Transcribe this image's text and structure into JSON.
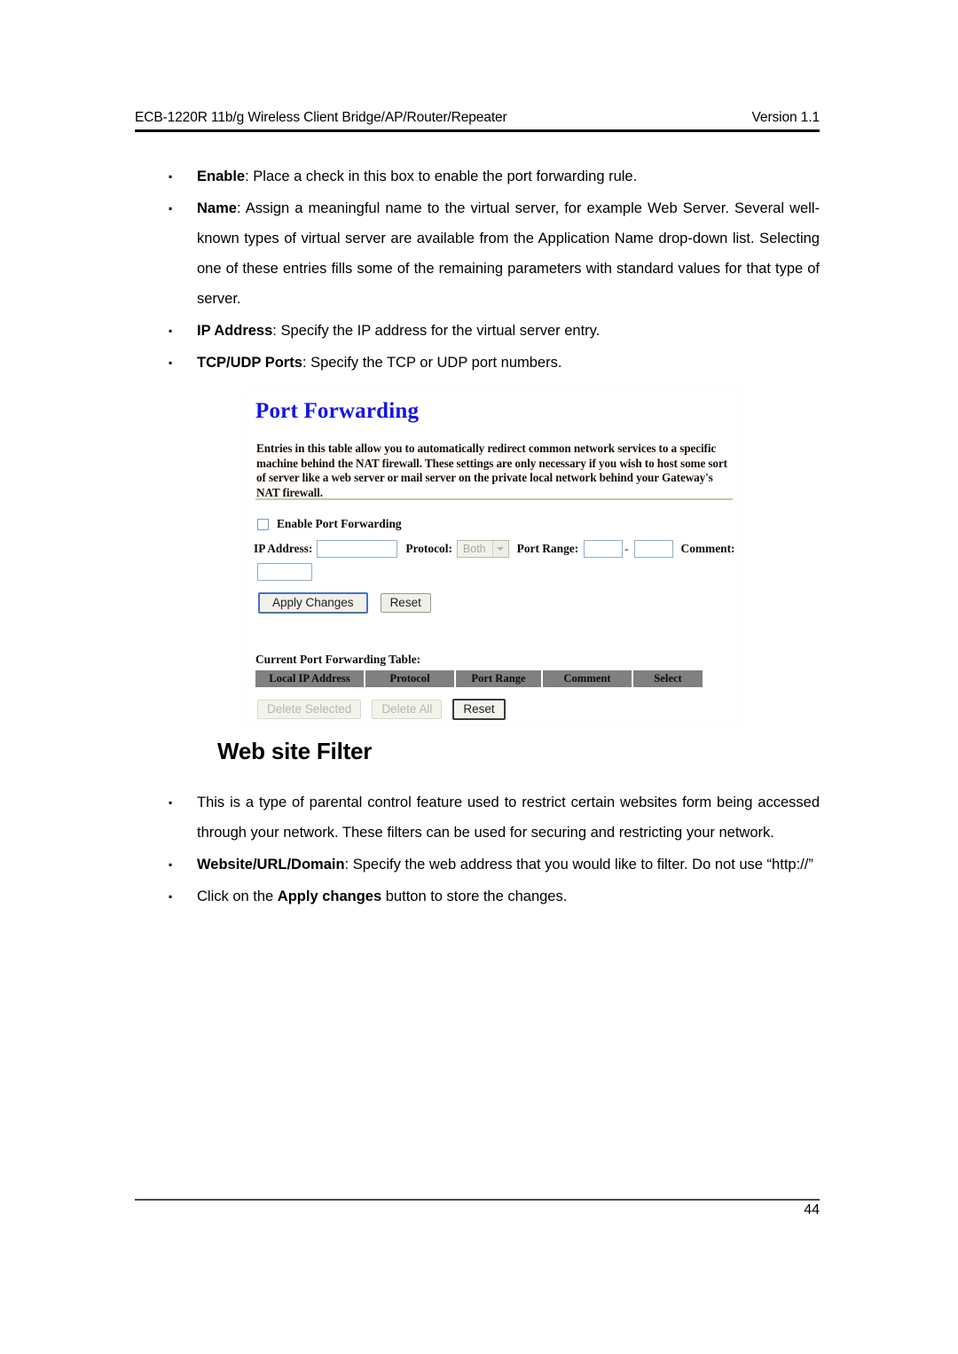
{
  "header": {
    "left": "ECB-1220R 11b/g Wireless Client Bridge/AP/Router/Repeater",
    "right": "Version 1.1"
  },
  "bullets_top": [
    {
      "bullet": "▪",
      "label": "Enable",
      "sep": ": ",
      "text": "Place a check in this box to enable the port forwarding rule."
    },
    {
      "bullet": "▪",
      "label": "Name",
      "sep": ": ",
      "text": "Assign a meaningful name to the virtual server, for example Web Server. Several well-known types of virtual server are available from the Application Name drop-down list. Selecting one of these entries fills some of the remaining parameters with standard values for that type of server."
    },
    {
      "bullet": "▪",
      "label": "IP Address",
      "sep": ": ",
      "text": "Specify the IP address for the virtual server entry."
    },
    {
      "bullet": "▪",
      "label": "TCP/UDP Ports",
      "sep": ": ",
      "text": "Specify the TCP or UDP port numbers."
    }
  ],
  "screenshot": {
    "title": "Port Forwarding",
    "description": "Entries in this table allow you to automatically redirect common network services to a specific machine behind the NAT firewall. These settings are only necessary if you wish to host some sort of server like a web server or mail server on the private local network behind your Gateway's NAT firewall.",
    "enable_checkbox_label": "Enable Port Forwarding",
    "enable_checked": "false",
    "fields": {
      "ip_address_label": "IP Address:",
      "ip_address_value": "",
      "protocol_label": "Protocol:",
      "protocol_value": "Both",
      "port_range_label": "Port Range:",
      "port_start_value": "",
      "port_end_value": "",
      "range_dash": "-",
      "comment_label": "Comment:",
      "comment_value": ""
    },
    "buttons": {
      "apply_changes": "Apply Changes",
      "reset_top": "Reset",
      "delete_selected": "Delete Selected",
      "delete_all": "Delete All",
      "reset_bottom": "Reset"
    },
    "table": {
      "caption": "Current Port Forwarding Table:",
      "columns": [
        "Local IP Address",
        "Protocol",
        "Port Range",
        "Comment",
        "Select"
      ],
      "rows": []
    },
    "colors": {
      "title_blue": "#1414e6",
      "rule_khaki": "#c9c9a2",
      "table_header_grey": "#808080",
      "primary_button_border": "#4d72b8"
    }
  },
  "section_heading": "Web site Filter",
  "bullets_bottom": [
    {
      "bullet": "▪",
      "label": "",
      "sep": "",
      "text": "This is a type of parental control feature used to restrict certain websites form being accessed through your network. These filters can be used for securing and restricting your network."
    },
    {
      "bullet": "▪",
      "label": "Website/URL/Domain",
      "sep": ": ",
      "text": "Specify the web address that you would like to filter. Do not use “http://”"
    },
    {
      "bullet": "▪",
      "label": "",
      "sep": "",
      "text": "Click on the Apply changes button to store the changes."
    }
  ],
  "bullet_bottom_last": {
    "pre": "Click on the ",
    "bold": "Apply changes",
    "post": " button to store the changes."
  },
  "footer": {
    "page_number": "44"
  }
}
